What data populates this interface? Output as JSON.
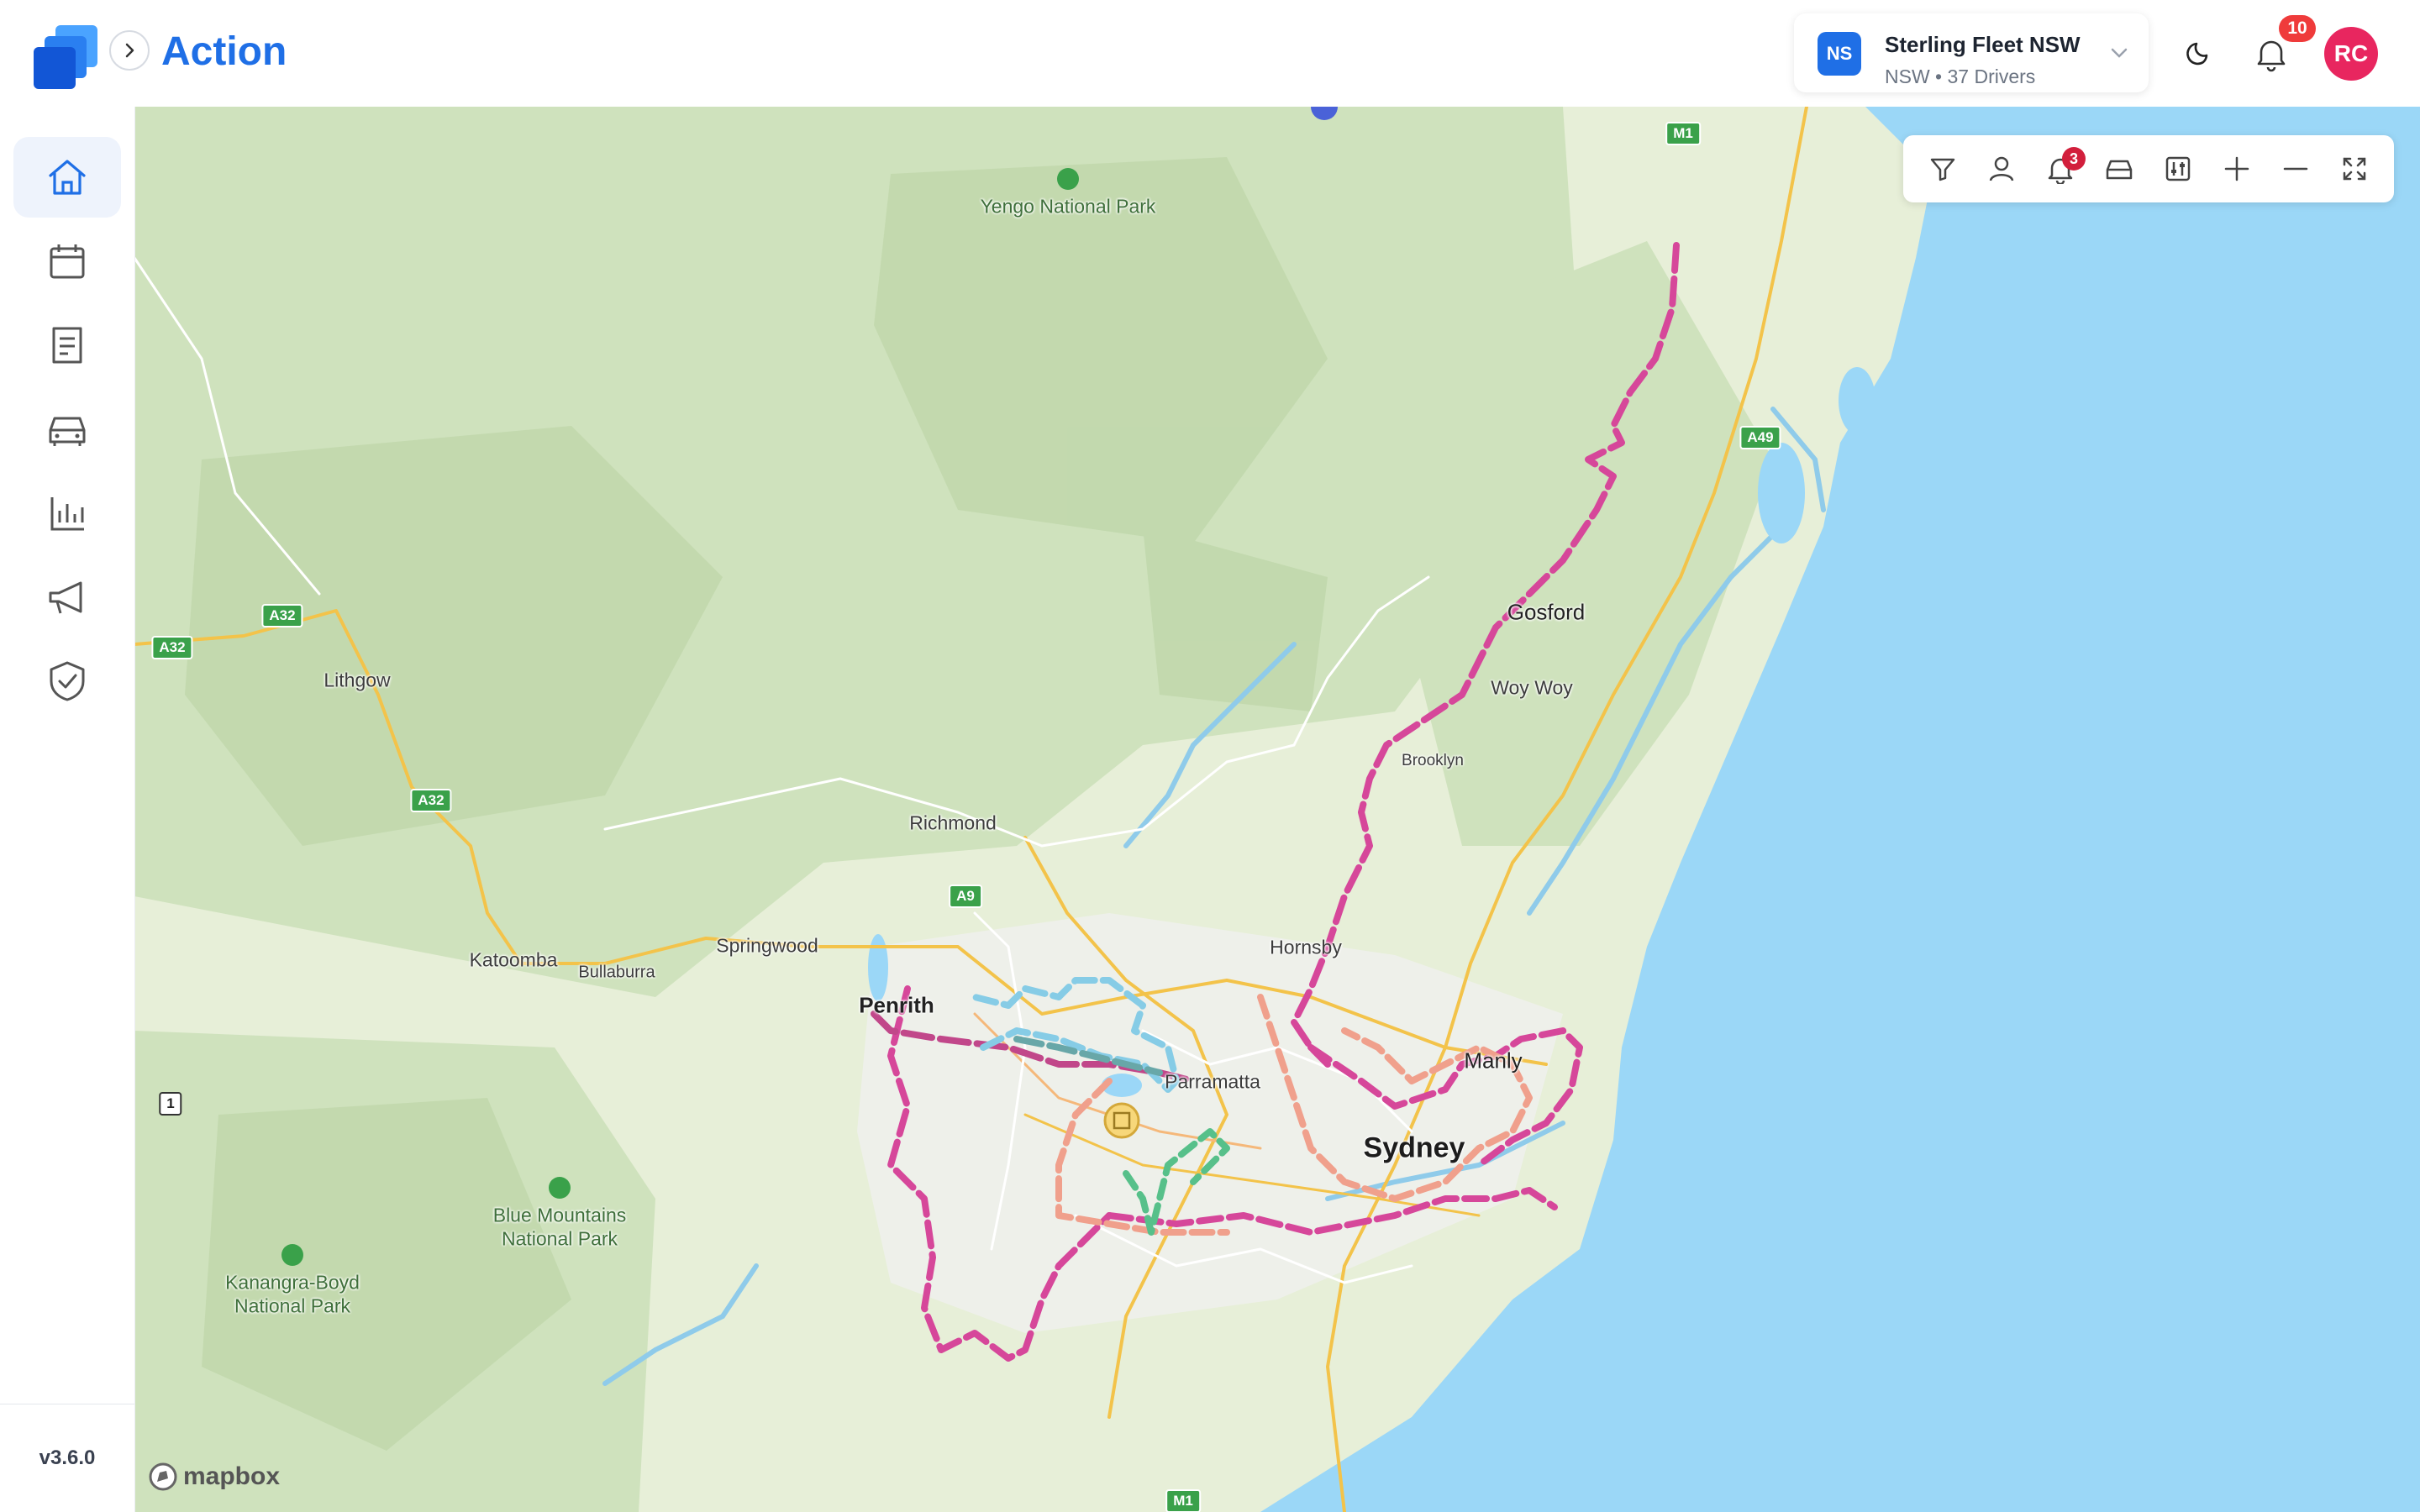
{
  "header": {
    "app_title": "Action",
    "fleet": {
      "badge": "NS",
      "name": "Sterling Fleet NSW",
      "subtitle": "NSW • 37 Drivers"
    },
    "notifications_count": "10",
    "user_initials": "RC"
  },
  "sidebar": {
    "items": [
      {
        "name": "home",
        "icon": "home-icon",
        "active": true
      },
      {
        "name": "calendar",
        "icon": "calendar-icon",
        "active": false
      },
      {
        "name": "documents",
        "icon": "document-icon",
        "active": false
      },
      {
        "name": "vehicles",
        "icon": "car-icon",
        "active": false
      },
      {
        "name": "reports",
        "icon": "bar-chart-icon",
        "active": false
      },
      {
        "name": "announcements",
        "icon": "megaphone-icon",
        "active": false
      },
      {
        "name": "compliance",
        "icon": "shield-check-icon",
        "active": false
      }
    ],
    "version": "v3.6.0"
  },
  "map": {
    "toolbar": {
      "tools": [
        "filter-icon",
        "driver-icon",
        "alert-icon",
        "vehicle-icon",
        "settings-icon",
        "zoom-in-icon",
        "zoom-out-icon",
        "fullscreen-icon"
      ],
      "alert_count": "3"
    },
    "places": {
      "sydney": "Sydney",
      "penrith": "Penrith",
      "parramatta": "Parramatta",
      "manly": "Manly",
      "gosford": "Gosford",
      "woy_woy": "Woy Woy",
      "brooklyn": "Brooklyn",
      "hornsby": "Hornsby",
      "richmond": "Richmond",
      "springwood": "Springwood",
      "katoomba": "Katoomba",
      "bullaburra": "Bullaburra",
      "lithgow": "Lithgow",
      "yengo": "Yengo National Park",
      "blue_mountains_1": "Blue Mountains",
      "blue_mountains_2": "National Park",
      "kanangra_1": "Kanangra-Boyd",
      "kanangra_2": "National Park"
    },
    "road_shields": {
      "m1_top": "M1",
      "m1_bottom": "M1",
      "a49": "A49",
      "a32_a": "A32",
      "a32_b": "A32",
      "a32_c": "A32",
      "a9": "A9",
      "hwy1": "1"
    },
    "attribution": "mapbox",
    "colors": {
      "water": "#9bd7f7",
      "land": "#e7efd8",
      "forest": "#cfe2bd",
      "route_magenta": "#d6479a",
      "route_salmon": "#f0a08c",
      "route_blue": "#86cce6",
      "route_green": "#57c08a"
    }
  }
}
